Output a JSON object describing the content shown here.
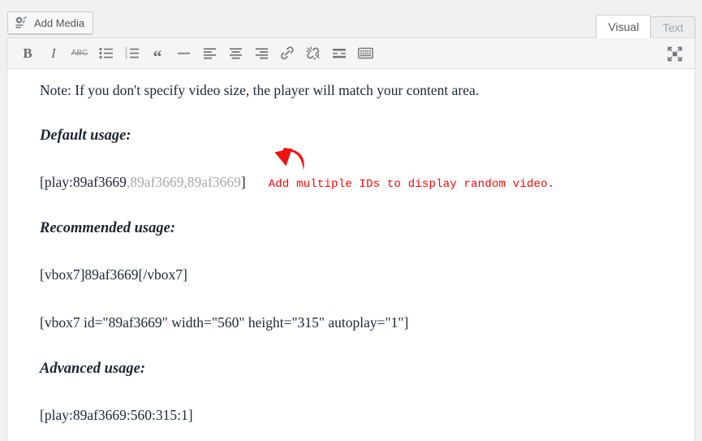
{
  "app": {
    "name": "wordpress-post-editor",
    "accent_red": "#ff0000",
    "text_color": "#20283a",
    "dim_color": "#a8a8a8",
    "chrome_bg": "#f1f1f1",
    "toolbar_bg": "#f5f5f5"
  },
  "top": {
    "add_media_label": "Add Media",
    "add_media_icon": "media-icon",
    "tabs": [
      {
        "label": "Visual",
        "active": true,
        "name": "tab-visual"
      },
      {
        "label": "Text",
        "active": false,
        "name": "tab-text"
      }
    ]
  },
  "toolbar": {
    "buttons": [
      {
        "name": "bold-icon",
        "glyph": "B",
        "title": "Bold"
      },
      {
        "name": "italic-icon",
        "glyph": "I",
        "title": "Italic"
      },
      {
        "name": "strikethrough-icon",
        "glyph": "ABC",
        "title": "Strikethrough"
      },
      {
        "name": "bulleted-list-icon",
        "title": "Bulleted list"
      },
      {
        "name": "numbered-list-icon",
        "title": "Numbered list"
      },
      {
        "name": "blockquote-icon",
        "glyph": "“",
        "title": "Blockquote"
      },
      {
        "name": "horizontal-rule-icon",
        "title": "Horizontal line"
      },
      {
        "name": "align-left-icon",
        "title": "Align left"
      },
      {
        "name": "align-center-icon",
        "title": "Align center"
      },
      {
        "name": "align-right-icon",
        "title": "Align right"
      },
      {
        "name": "insert-link-icon",
        "title": "Insert/edit link"
      },
      {
        "name": "unlink-icon",
        "title": "Remove link"
      },
      {
        "name": "read-more-tag-icon",
        "title": "Insert Read More tag"
      },
      {
        "name": "toolbar-toggle-icon",
        "title": "Toolbar Toggle"
      }
    ],
    "fullscreen_icon": "distraction-free-writing-icon"
  },
  "content": {
    "note": "Note: If you don't specify video size, the player will match your content area.",
    "heading_default": "Default usage:",
    "shortcode_default_main": "[play:89af3669",
    "shortcode_default_dim": ",89af3669,89af3669",
    "shortcode_default_end": "]",
    "annotation": "Add multiple IDs to display random video.",
    "heading_recommended": "Recommended usage:",
    "shortcode_vbox_simple": "[vbox7]89af3669[/vbox7]",
    "shortcode_vbox_full": "[vbox7 id=\"89af3669\" width=\"560\" height=\"315\" autoplay=\"1\"]",
    "heading_advanced": "Advanced usage:",
    "shortcode_advanced": "[play:89af3669:560:315:1]"
  }
}
